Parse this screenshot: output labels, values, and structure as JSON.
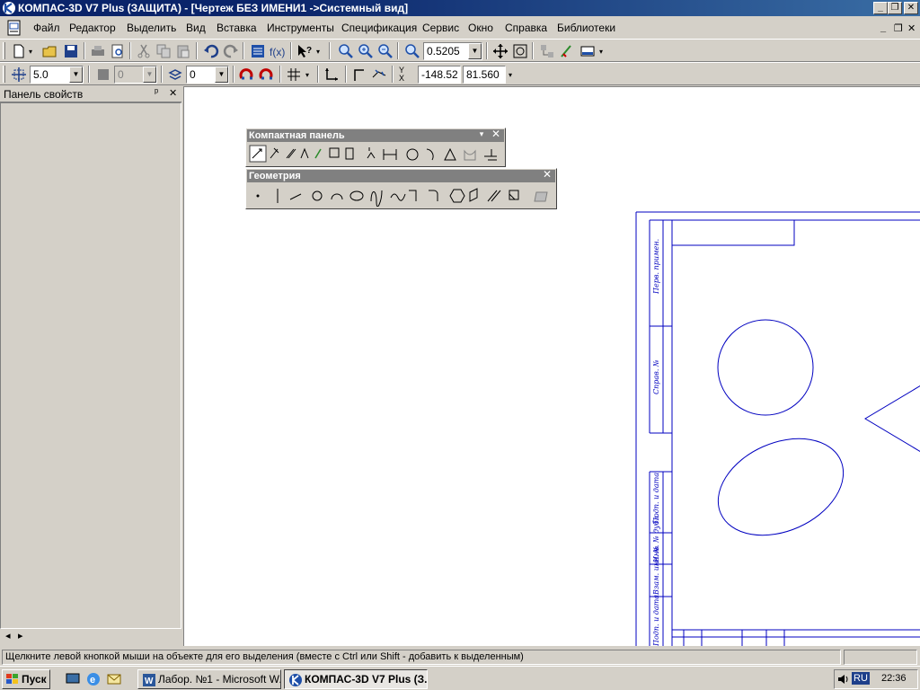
{
  "window": {
    "title": "КОМПАС-3D V7 Plus (ЗАЩИТА) - [Чертеж БЕЗ ИМЕНИ1 ->Системный вид]",
    "minimize": "_",
    "maximize": "❐",
    "close": "✕"
  },
  "menu": {
    "items": [
      "Файл",
      "Редактор",
      "Выделить",
      "Вид",
      "Вставка",
      "Инструменты",
      "Спецификация",
      "Сервис",
      "Окно",
      "Справка",
      "Библиотеки"
    ],
    "doc_minimize": "_",
    "doc_restore": "❐",
    "doc_close": "✕"
  },
  "toolbar1": {
    "zoom_value": "0.5205",
    "fx_label": "f(x)"
  },
  "toolbar2": {
    "step_value": "5.0",
    "layer_value": "0",
    "style_value": "0",
    "coord_x": "-148.52",
    "coord_y": "81.560",
    "xy_label": "Y\nX"
  },
  "property_panel": {
    "title": "Панель свойств",
    "pin": "ᵖ",
    "close": "✕",
    "scroll_left": "◂",
    "scroll_right": "▸"
  },
  "compact_panel": {
    "title": "Компактная панель",
    "menu": "▾",
    "close": "✕"
  },
  "geometry_panel": {
    "title": "Геометрия",
    "close": "✕"
  },
  "drawing": {
    "stamp_labels": [
      "Перв. примен.",
      "Справ. №",
      "Подп. и дата",
      "Инв. № дубл.",
      "Взам. инв. №",
      "Подп. и дата"
    ]
  },
  "statusbar": {
    "message": "Щелкните левой кнопкой мыши на объекте для его выделения (вместе с Ctrl или Shift - добавить к выделенным)"
  },
  "taskbar": {
    "start": "Пуск",
    "tasks": [
      {
        "label": "Лабор. №1 - Microsoft W...",
        "active": false
      },
      {
        "label": "КОМПАС-3D V7 Plus (З...",
        "active": true
      }
    ],
    "lang": "RU",
    "clock": "22:36"
  },
  "colors": {
    "title_active": "#0a246a",
    "panel_title": "#808080",
    "drawing_line": "#0000c0",
    "accent_icon": "#1e4fa8"
  }
}
